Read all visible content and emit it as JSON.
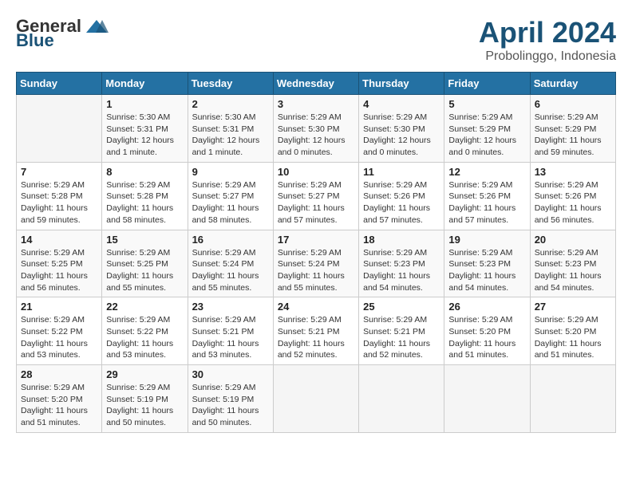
{
  "header": {
    "logo_general": "General",
    "logo_blue": "Blue",
    "month_title": "April 2024",
    "subtitle": "Probolinggo, Indonesia"
  },
  "days_of_week": [
    "Sunday",
    "Monday",
    "Tuesday",
    "Wednesday",
    "Thursday",
    "Friday",
    "Saturday"
  ],
  "weeks": [
    [
      {
        "day": "",
        "info": ""
      },
      {
        "day": "1",
        "info": "Sunrise: 5:30 AM\nSunset: 5:31 PM\nDaylight: 12 hours\nand 1 minute."
      },
      {
        "day": "2",
        "info": "Sunrise: 5:30 AM\nSunset: 5:31 PM\nDaylight: 12 hours\nand 1 minute."
      },
      {
        "day": "3",
        "info": "Sunrise: 5:29 AM\nSunset: 5:30 PM\nDaylight: 12 hours\nand 0 minutes."
      },
      {
        "day": "4",
        "info": "Sunrise: 5:29 AM\nSunset: 5:30 PM\nDaylight: 12 hours\nand 0 minutes."
      },
      {
        "day": "5",
        "info": "Sunrise: 5:29 AM\nSunset: 5:29 PM\nDaylight: 12 hours\nand 0 minutes."
      },
      {
        "day": "6",
        "info": "Sunrise: 5:29 AM\nSunset: 5:29 PM\nDaylight: 11 hours\nand 59 minutes."
      }
    ],
    [
      {
        "day": "7",
        "info": "Sunrise: 5:29 AM\nSunset: 5:28 PM\nDaylight: 11 hours\nand 59 minutes."
      },
      {
        "day": "8",
        "info": "Sunrise: 5:29 AM\nSunset: 5:28 PM\nDaylight: 11 hours\nand 58 minutes."
      },
      {
        "day": "9",
        "info": "Sunrise: 5:29 AM\nSunset: 5:27 PM\nDaylight: 11 hours\nand 58 minutes."
      },
      {
        "day": "10",
        "info": "Sunrise: 5:29 AM\nSunset: 5:27 PM\nDaylight: 11 hours\nand 57 minutes."
      },
      {
        "day": "11",
        "info": "Sunrise: 5:29 AM\nSunset: 5:26 PM\nDaylight: 11 hours\nand 57 minutes."
      },
      {
        "day": "12",
        "info": "Sunrise: 5:29 AM\nSunset: 5:26 PM\nDaylight: 11 hours\nand 57 minutes."
      },
      {
        "day": "13",
        "info": "Sunrise: 5:29 AM\nSunset: 5:26 PM\nDaylight: 11 hours\nand 56 minutes."
      }
    ],
    [
      {
        "day": "14",
        "info": "Sunrise: 5:29 AM\nSunset: 5:25 PM\nDaylight: 11 hours\nand 56 minutes."
      },
      {
        "day": "15",
        "info": "Sunrise: 5:29 AM\nSunset: 5:25 PM\nDaylight: 11 hours\nand 55 minutes."
      },
      {
        "day": "16",
        "info": "Sunrise: 5:29 AM\nSunset: 5:24 PM\nDaylight: 11 hours\nand 55 minutes."
      },
      {
        "day": "17",
        "info": "Sunrise: 5:29 AM\nSunset: 5:24 PM\nDaylight: 11 hours\nand 55 minutes."
      },
      {
        "day": "18",
        "info": "Sunrise: 5:29 AM\nSunset: 5:23 PM\nDaylight: 11 hours\nand 54 minutes."
      },
      {
        "day": "19",
        "info": "Sunrise: 5:29 AM\nSunset: 5:23 PM\nDaylight: 11 hours\nand 54 minutes."
      },
      {
        "day": "20",
        "info": "Sunrise: 5:29 AM\nSunset: 5:23 PM\nDaylight: 11 hours\nand 54 minutes."
      }
    ],
    [
      {
        "day": "21",
        "info": "Sunrise: 5:29 AM\nSunset: 5:22 PM\nDaylight: 11 hours\nand 53 minutes."
      },
      {
        "day": "22",
        "info": "Sunrise: 5:29 AM\nSunset: 5:22 PM\nDaylight: 11 hours\nand 53 minutes."
      },
      {
        "day": "23",
        "info": "Sunrise: 5:29 AM\nSunset: 5:21 PM\nDaylight: 11 hours\nand 53 minutes."
      },
      {
        "day": "24",
        "info": "Sunrise: 5:29 AM\nSunset: 5:21 PM\nDaylight: 11 hours\nand 52 minutes."
      },
      {
        "day": "25",
        "info": "Sunrise: 5:29 AM\nSunset: 5:21 PM\nDaylight: 11 hours\nand 52 minutes."
      },
      {
        "day": "26",
        "info": "Sunrise: 5:29 AM\nSunset: 5:20 PM\nDaylight: 11 hours\nand 51 minutes."
      },
      {
        "day": "27",
        "info": "Sunrise: 5:29 AM\nSunset: 5:20 PM\nDaylight: 11 hours\nand 51 minutes."
      }
    ],
    [
      {
        "day": "28",
        "info": "Sunrise: 5:29 AM\nSunset: 5:20 PM\nDaylight: 11 hours\nand 51 minutes."
      },
      {
        "day": "29",
        "info": "Sunrise: 5:29 AM\nSunset: 5:19 PM\nDaylight: 11 hours\nand 50 minutes."
      },
      {
        "day": "30",
        "info": "Sunrise: 5:29 AM\nSunset: 5:19 PM\nDaylight: 11 hours\nand 50 minutes."
      },
      {
        "day": "",
        "info": ""
      },
      {
        "day": "",
        "info": ""
      },
      {
        "day": "",
        "info": ""
      },
      {
        "day": "",
        "info": ""
      }
    ]
  ]
}
